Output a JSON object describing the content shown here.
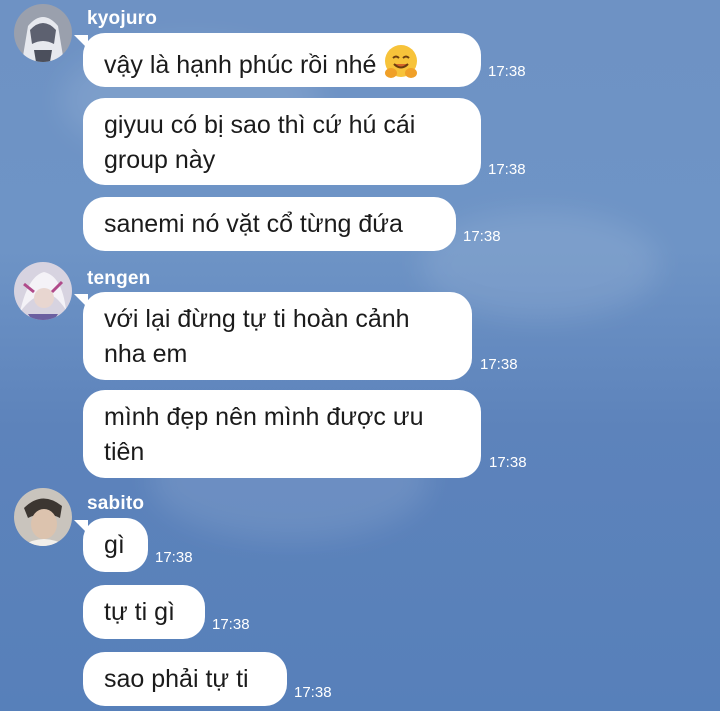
{
  "messages": [
    {
      "sender": "kyojuro",
      "bubbles": [
        {
          "text": "vậy là hạnh phúc rồi nhé",
          "emoji": "hugging-face",
          "time": "17:38"
        },
        {
          "lines": [
            "giyuu có bị sao thì cứ hú cái",
            "group này"
          ],
          "time": "17:38"
        },
        {
          "text": "sanemi nó vặt cổ từng đứa",
          "time": "17:38"
        }
      ]
    },
    {
      "sender": "tengen",
      "bubbles": [
        {
          "lines": [
            "với lại đừng tự ti hoàn cảnh",
            "nha em"
          ],
          "time": "17:38"
        },
        {
          "lines": [
            "mình đẹp nên mình được ưu",
            "tiên"
          ],
          "time": "17:38"
        }
      ]
    },
    {
      "sender": "sabito",
      "bubbles": [
        {
          "text": "gì",
          "time": "17:38"
        },
        {
          "text": "tự ti gì",
          "time": "17:38"
        },
        {
          "text": "sao phải tự ti",
          "time": "17:38"
        }
      ]
    }
  ],
  "colors": {
    "background": "#6a8fc3",
    "bubble": "#ffffff",
    "text": "#1b1b1b",
    "meta_text": "#ffffff"
  }
}
